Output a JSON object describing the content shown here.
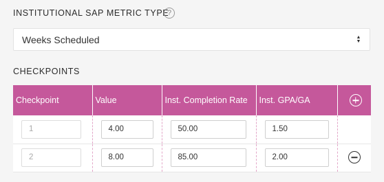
{
  "metric": {
    "label": "INSTITUTIONAL SAP METRIC TYPE",
    "help_glyph": "?",
    "selected": "Weeks Scheduled"
  },
  "checkpoints": {
    "label": "CHECKPOINTS",
    "columns": [
      "Checkpoint",
      "Value",
      "Inst. Completion Rate",
      "Inst. GPA/GA"
    ],
    "rows": [
      {
        "checkpoint": "1",
        "value": "4.00",
        "completion_rate": "50.00",
        "gpa": "1.50"
      },
      {
        "checkpoint": "2",
        "value": "8.00",
        "completion_rate": "85.00",
        "gpa": "2.00"
      }
    ]
  },
  "colors": {
    "header_bg": "#c5589b",
    "page_bg": "#f5f5f5"
  },
  "icons": {
    "help": "question-circle-icon",
    "add": "plus-circle-icon",
    "remove": "minus-circle-icon",
    "select": "sort-arrows-icon"
  }
}
